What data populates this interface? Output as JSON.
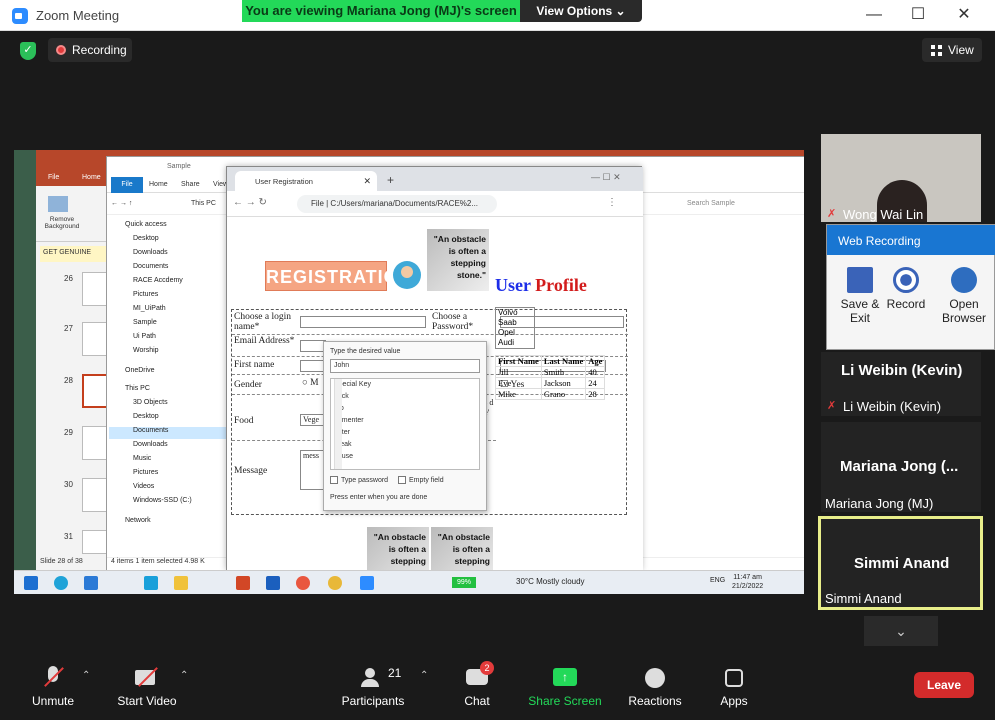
{
  "window": {
    "title": "Zoom Meeting"
  },
  "banner": {
    "viewing": "You are viewing Mariana Jong (MJ)'s screen",
    "view_options": "View Options"
  },
  "meeting": {
    "recording_label": "Recording",
    "view_label": "View"
  },
  "shared_screen": {
    "ppt": {
      "tabs": [
        "File",
        "Home"
      ],
      "remove_bg": "Remove Background",
      "genuine": "GET GENUINE",
      "slides": [
        "26",
        "27",
        "28",
        "29",
        "30",
        "31"
      ],
      "status": "Slide 28 of 38"
    },
    "explorer": {
      "title": "Sample",
      "ribbon_tabs": [
        "File",
        "Home",
        "Share",
        "View"
      ],
      "path": "This PC",
      "nav": [
        "Quick access",
        "Desktop",
        "Downloads",
        "Documents",
        "RACE Accdemy",
        "Pictures",
        "MI_UiPath",
        "Sample",
        "Ui Path",
        "Worship",
        "OneDrive",
        "This PC",
        "3D Objects",
        "Desktop",
        "Documents",
        "Downloads",
        "Music",
        "Pictures",
        "Videos",
        "Windows-SSD (C:)",
        "Network"
      ],
      "status": "4 items   1 item selected  4.98 K",
      "search_placeholder": "Search Sample"
    },
    "chrome": {
      "tab_title": "User Registration",
      "url_label": "File",
      "url": "C:/Users/mariana/Documents/RACE%2..."
    },
    "page": {
      "banner": "REGISTRATION",
      "quote": "\"An obstacle is often a stepping stone.\"",
      "title_user": "User",
      "title_profile": "Profile",
      "labels": {
        "login": "Choose a login name*",
        "password": "Choose a Password*",
        "email": "Email Address*",
        "first": "First name",
        "gender": "Gender",
        "food": "Food",
        "message": "Message",
        "yes": "Yes",
        "m": "M",
        "veg": "Vege",
        "mess": "mess",
        "cut": "ls d le' t)"
      },
      "cars": [
        "Volvo",
        "Saab",
        "Opel",
        "Audi"
      ],
      "table": {
        "headers": [
          "First Name",
          "Last Name",
          "Age"
        ],
        "rows": [
          [
            "Jill",
            "Smith",
            "40"
          ],
          [
            "Eve",
            "Jackson",
            "24"
          ],
          [
            "Mike",
            "Grano",
            "28"
          ]
        ]
      }
    },
    "popup": {
      "header": "Type the desired value",
      "value": "John",
      "items": [
        "Special Key",
        "back",
        "tab",
        "numenter",
        "enter",
        "break",
        "pause"
      ],
      "type_password": "Type password",
      "empty_field": "Empty field",
      "footer": "Press enter when you are done"
    },
    "taskbar": {
      "battery": "99%",
      "weather": "30°C  Mostly cloudy",
      "lang": "ENG",
      "time": "11:47 am",
      "date": "21/2/2022"
    }
  },
  "participants": [
    {
      "name": "Wong Wai Lin",
      "muted": true
    },
    {
      "name": "Li Weibin (Kevin)",
      "display": "Li Weibin (Kevin)",
      "muted": true
    },
    {
      "name": "Mariana Jong (MJ)",
      "display": "Mariana Jong (...",
      "muted": false
    },
    {
      "name": "Simmi Anand",
      "display": "Simmi Anand",
      "muted": false
    }
  ],
  "web_recording": {
    "title": "Web Recording",
    "save": "Save & Exit",
    "record": "Record",
    "browser": "Open Browser"
  },
  "toolbar": {
    "unmute": "Unmute",
    "start_video": "Start Video",
    "participants": "Participants",
    "participant_count": "21",
    "chat": "Chat",
    "chat_badge": "2",
    "share": "Share Screen",
    "reactions": "Reactions",
    "apps": "Apps",
    "leave": "Leave"
  },
  "colors": {
    "zoom_blue": "#2d8cff",
    "share_green": "#23d959",
    "leave_red": "#d32b2b",
    "active_speaker": "#e8ee8a"
  }
}
